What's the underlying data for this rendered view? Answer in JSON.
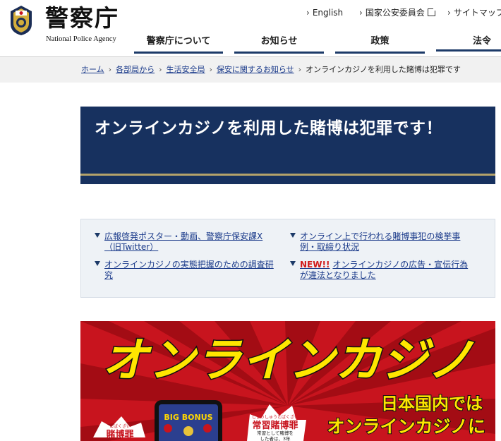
{
  "header": {
    "site_title": "警察庁",
    "site_subtitle": "National Police Agency",
    "util_links": [
      "English",
      "国家公安委員会",
      "サイトマップ"
    ],
    "nav": [
      "警察庁について",
      "お知らせ",
      "政策",
      "法令"
    ]
  },
  "breadcrumb": [
    "ホーム",
    "各部局から",
    "生活安全局",
    "保安に関するお知らせ",
    "オンラインカジノを利用した賭博は犯罪です"
  ],
  "page": {
    "title": "オンラインカジノを利用した賭博は犯罪です！"
  },
  "anchors": [
    "広報啓発ポスター・動画、警察庁保安課X（旧Twitter）",
    "オンライン上で行われる賭博事犯の検挙事例・取締り状況",
    "オンラインカジノの実態把握のための調査研究",
    "オンラインカジノの広告・宣伝行為が違法となりました"
  ],
  "new_badge": "NEW!!",
  "poster": {
    "headline": "オンラインカジノ",
    "line1": "日本国内では",
    "line2": "オンラインカジノに",
    "burst_title": "常習賭博罪",
    "burst_ruby": "じょうしゅうとばくざい",
    "burst_text1": "常習として賭博を",
    "burst_text2": "した者は、3年",
    "left_burst_ruby": "とばくざい",
    "left_burst_title": "賭博罪",
    "phone_label": "BIG BONUS"
  },
  "colors": {
    "navy": "#17315f",
    "nav_underline": "#1c3a68",
    "gold": "#b4a26a",
    "link": "#1a3a8a",
    "poster_red": "#c8141e",
    "poster_yellow": "#ffe600",
    "new_red": "#d21a1a"
  },
  "icons": [
    "police-emblem-icon",
    "chevron-right-icon",
    "external-link-icon",
    "triangle-down-icon"
  ]
}
